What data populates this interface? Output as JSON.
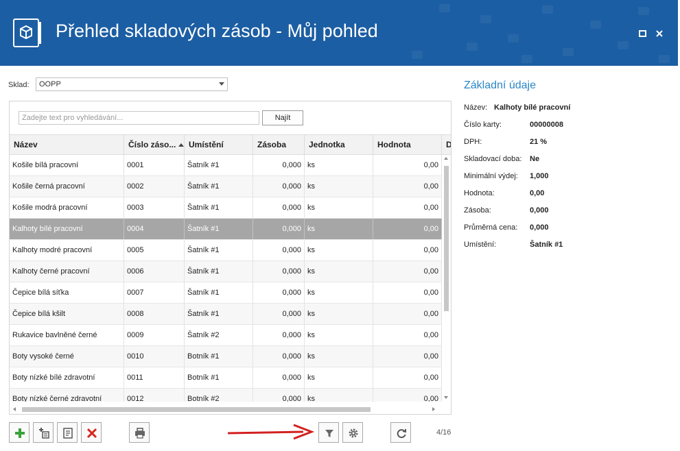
{
  "window": {
    "title": "Přehled skladových zásob - Můj pohled"
  },
  "filter": {
    "sklad_label": "Sklad:",
    "sklad_value": "OOPP"
  },
  "search": {
    "placeholder": "Zadejte text pro vyhledávání...",
    "button_label": "Najít"
  },
  "grid": {
    "columns": [
      "Název",
      "Číslo záso...",
      "Umístění",
      "Zásoba",
      "Jednotka",
      "Hodnota",
      "D"
    ],
    "sorted_column": "Číslo záso...",
    "rows": [
      {
        "nazev": "Košile bílá pracovní",
        "cislo": "0001",
        "umisteni": "Šatník #1",
        "zasoba": "0,000",
        "jednotka": "ks",
        "hodnota": "0,00"
      },
      {
        "nazev": "Košile černá pracovní",
        "cislo": "0002",
        "umisteni": "Šatník #1",
        "zasoba": "0,000",
        "jednotka": "ks",
        "hodnota": "0,00"
      },
      {
        "nazev": "Košile modrá pracovní",
        "cislo": "0003",
        "umisteni": "Šatník #1",
        "zasoba": "0,000",
        "jednotka": "ks",
        "hodnota": "0,00"
      },
      {
        "nazev": "Kalhoty bílé pracovní",
        "cislo": "0004",
        "umisteni": "Šatník #1",
        "zasoba": "0,000",
        "jednotka": "ks",
        "hodnota": "0,00"
      },
      {
        "nazev": "Kalhoty modré pracovní",
        "cislo": "0005",
        "umisteni": "Šatník #1",
        "zasoba": "0,000",
        "jednotka": "ks",
        "hodnota": "0,00"
      },
      {
        "nazev": "Kalhoty černé pracovní",
        "cislo": "0006",
        "umisteni": "Šatník #1",
        "zasoba": "0,000",
        "jednotka": "ks",
        "hodnota": "0,00"
      },
      {
        "nazev": "Čepice bílá síťka",
        "cislo": "0007",
        "umisteni": "Šatník #1",
        "zasoba": "0,000",
        "jednotka": "ks",
        "hodnota": "0,00"
      },
      {
        "nazev": "Čepice bílá kšilt",
        "cislo": "0008",
        "umisteni": "Šatník #1",
        "zasoba": "0,000",
        "jednotka": "ks",
        "hodnota": "0,00"
      },
      {
        "nazev": "Rukavice bavlněné černé",
        "cislo": "0009",
        "umisteni": "Šatník #2",
        "zasoba": "0,000",
        "jednotka": "ks",
        "hodnota": "0,00"
      },
      {
        "nazev": "Boty vysoké černé",
        "cislo": "0010",
        "umisteni": "Botník #1",
        "zasoba": "0,000",
        "jednotka": "ks",
        "hodnota": "0,00"
      },
      {
        "nazev": "Boty nízké bílé zdravotní",
        "cislo": "0011",
        "umisteni": "Botník #1",
        "zasoba": "0,000",
        "jednotka": "ks",
        "hodnota": "0,00"
      },
      {
        "nazev": "Boty nízké černé zdravotní",
        "cislo": "0012",
        "umisteni": "Botník #2",
        "zasoba": "0,000",
        "jednotka": "ks",
        "hodnota": "0,00"
      }
    ],
    "selected_row": 3
  },
  "toolbar": {
    "buttons": [
      "add-icon",
      "add-subitem-icon",
      "edit-icon",
      "delete-icon",
      "print-icon",
      "filter-icon",
      "settings-icon",
      "refresh-icon"
    ],
    "pager": "4/16"
  },
  "details": {
    "title": "Základní údaje",
    "fields": [
      {
        "label": "Název:",
        "value": "Kalhoty bílé pracovní"
      },
      {
        "label": "Číslo karty:",
        "value": "00000008"
      },
      {
        "label": "DPH:",
        "value": "21 %"
      },
      {
        "label": "Skladovací doba:",
        "value": "Ne"
      },
      {
        "label": "Minimální výdej:",
        "value": "1,000"
      },
      {
        "label": "Hodnota:",
        "value": "0,00"
      },
      {
        "label": "Zásoba:",
        "value": "0,000"
      },
      {
        "label": "Průměrná cena:",
        "value": "0,000"
      },
      {
        "label": "Umístění:",
        "value": "Šatník #1"
      }
    ]
  },
  "colors": {
    "titlebar": "#1c5ea3",
    "accent": "#2a86c8",
    "selected_row": "#a6a6a6",
    "add_green": "#3aa23a",
    "delete_red": "#d9261c",
    "annotation_red": "#d32020"
  }
}
